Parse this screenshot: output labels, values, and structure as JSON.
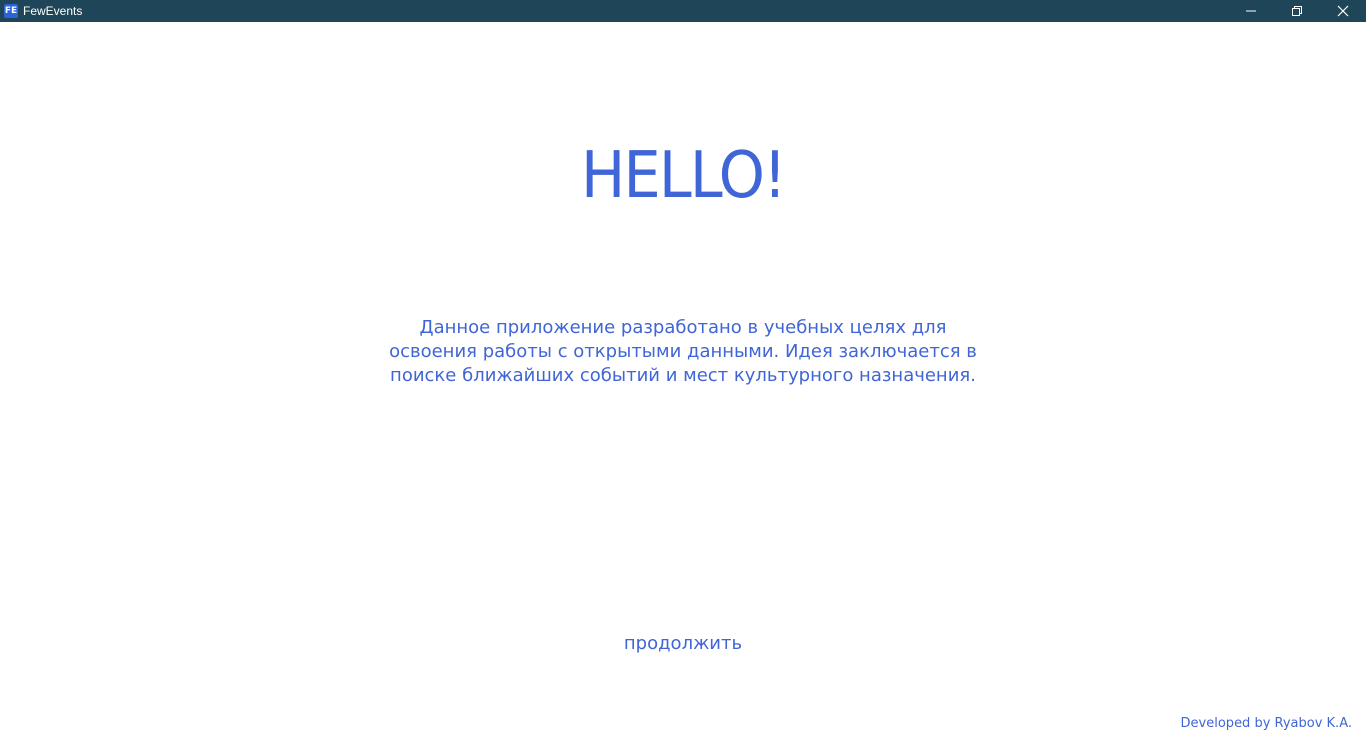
{
  "window": {
    "title": "FewEvents",
    "icon_text": "FE",
    "controls": [
      "minimize-icon",
      "restore-icon",
      "close-icon"
    ]
  },
  "main": {
    "heading": "HELLO!",
    "description": "Данное приложение разработано в учебных целях для освоения работы с открытыми данными. Идея заключается в поиске ближайших событий и мест культурного назначения.",
    "continue_label": "продолжить",
    "credits": "Developed by Ryabov K.A."
  },
  "colors": {
    "titlebar": "#1f4658",
    "accent": "#4065d6",
    "background": "#ffffff"
  }
}
